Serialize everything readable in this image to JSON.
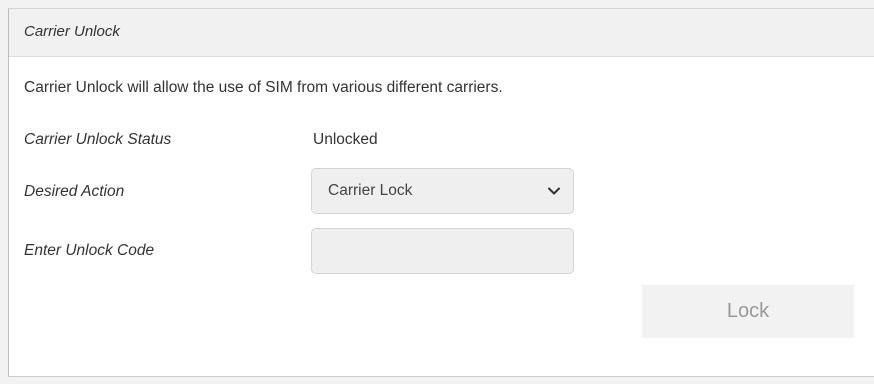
{
  "panel": {
    "title": "Carrier Unlock"
  },
  "description": "Carrier Unlock will allow the use of SIM from various different carriers.",
  "status": {
    "label": "Carrier Unlock Status",
    "value": "Unlocked"
  },
  "desired_action": {
    "label": "Desired Action",
    "selected": "Carrier Lock"
  },
  "unlock_code": {
    "label": "Enter Unlock Code",
    "value": ""
  },
  "actions": {
    "lock_label": "Lock"
  },
  "icons": {
    "select_chevron": "chevron-down-icon"
  },
  "colors": {
    "header_bg": "#f1f1f1",
    "field_bg": "#efefef",
    "button_bg": "#f2f2f2",
    "button_text": "#999999"
  }
}
